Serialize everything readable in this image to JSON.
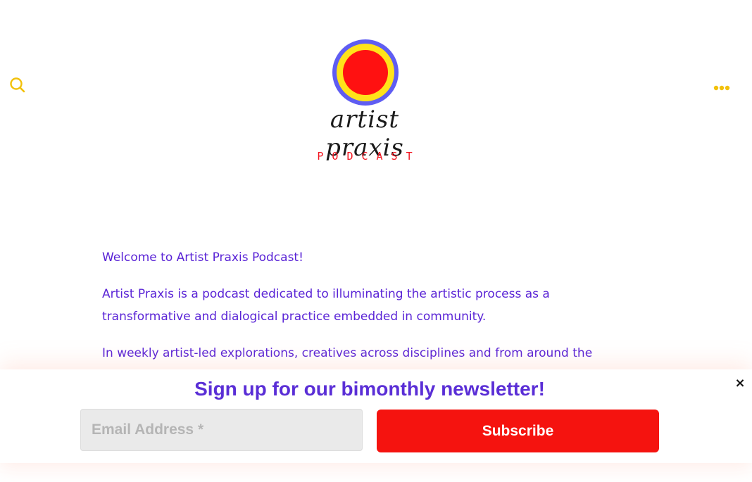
{
  "header": {
    "search_icon": "search-icon",
    "menu_icon": "more-horizontal-icon",
    "accent_color": "#f2c10b",
    "logo": {
      "wordmark": "artist praxis",
      "subtitle": "PODCAST"
    }
  },
  "content": {
    "paragraphs": [
      "Welcome to Artist Praxis Podcast!",
      "Artist Praxis is a podcast dedicated to illuminating the artistic process as a transformative and dialogical practice embedded in community.",
      "In weekly artist-led explorations, creatives across disciplines and from around the globe"
    ]
  },
  "newsletter": {
    "title": "Sign up for our bimonthly newsletter!",
    "email_placeholder": "Email Address *",
    "email_value": "",
    "subscribe_label": "Subscribe",
    "close_label": "×",
    "button_color": "#f5130f",
    "title_color": "#5a2ed6"
  }
}
